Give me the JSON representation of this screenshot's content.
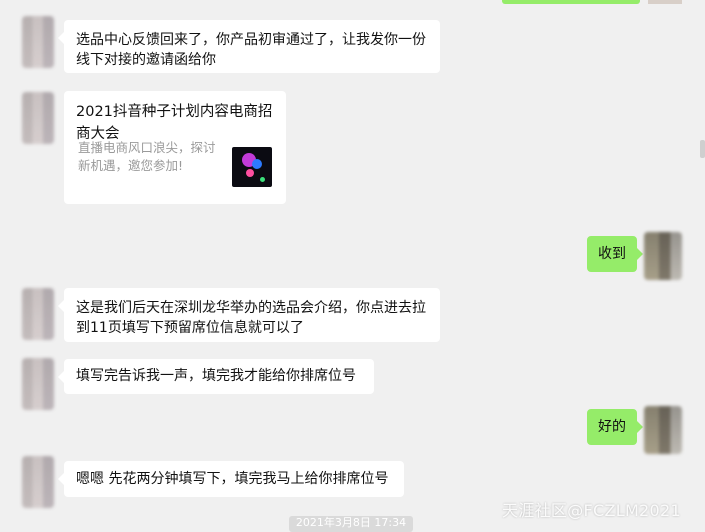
{
  "messages": [
    {
      "side": "left",
      "text": "选品中心反馈回来了，你产品初审通过了，让我发你一份线下对接的邀请函给你"
    },
    {
      "side": "left",
      "type": "link-card",
      "title": "2021抖音种子计划内容电商招商大会",
      "desc": "直播电商风口浪尖，探讨新机遇，邀您参加!",
      "thumb_icon": "event-poster-thumbnail"
    },
    {
      "side": "right",
      "text": "收到"
    },
    {
      "side": "left",
      "text": "这是我们后天在深圳龙华举办的选品会介绍，你点进去拉到11页填写下预留席位信息就可以了"
    },
    {
      "side": "left",
      "text": "填写完告诉我一声，填完我才能给你排席位号"
    },
    {
      "side": "right",
      "text": "好的"
    },
    {
      "side": "left",
      "text": "嗯嗯 先花两分钟填写下，填完我马上给你排席位号"
    }
  ],
  "timestamp": "2021年3月8日 17:34",
  "watermark": "天涯社区@FCZLM2021",
  "colors": {
    "background": "#f0f0f0",
    "sent_bubble": "#95ec69",
    "received_bubble": "#ffffff"
  }
}
